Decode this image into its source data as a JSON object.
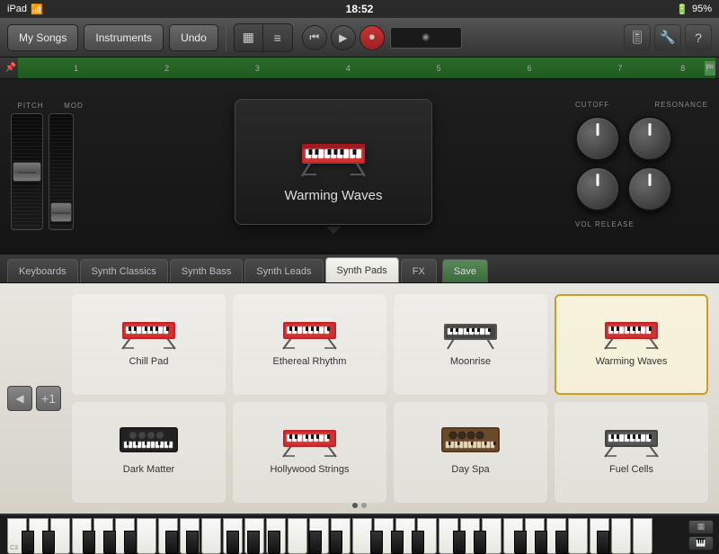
{
  "status_bar": {
    "left": "iPad",
    "wifi": "WiFi",
    "time": "18:52",
    "battery": "95%"
  },
  "toolbar": {
    "my_songs": "My Songs",
    "instruments": "Instruments",
    "undo": "Undo"
  },
  "synth": {
    "pitch_label": "PITCH",
    "mod_label": "MOD",
    "cutoff_label": "CUTOFF",
    "resonance_label": "RESONANCE",
    "vol_release_label": "VOL RELEASE",
    "instrument_name": "Warming Waves"
  },
  "preset_tabs": [
    {
      "id": "keyboards",
      "label": "Keyboards",
      "active": false
    },
    {
      "id": "synth-classics",
      "label": "Synth Classics",
      "active": false
    },
    {
      "id": "synth-bass",
      "label": "Synth Bass",
      "active": false
    },
    {
      "id": "synth-leads",
      "label": "Synth Leads",
      "active": false
    },
    {
      "id": "synth-pads",
      "label": "Synth Pads",
      "active": true
    },
    {
      "id": "fx",
      "label": "FX",
      "active": false
    },
    {
      "id": "save",
      "label": "Save",
      "active": false
    }
  ],
  "instruments": [
    {
      "id": "chill-pad",
      "label": "Chill Pad",
      "type": "keyboard",
      "selected": false
    },
    {
      "id": "ethereal-rhythm",
      "label": "Ethereal Rhythm",
      "type": "keyboard",
      "selected": false
    },
    {
      "id": "moonrise",
      "label": "Moonrise",
      "type": "keyboard2",
      "selected": false
    },
    {
      "id": "warming-waves",
      "label": "Warming Waves",
      "type": "keyboard",
      "selected": true
    },
    {
      "id": "dark-matter",
      "label": "Dark Matter",
      "type": "synth",
      "selected": false
    },
    {
      "id": "hollywood-strings",
      "label": "Hollywood Strings",
      "type": "keyboard",
      "selected": false
    },
    {
      "id": "day-spa",
      "label": "Day Spa",
      "type": "synth2",
      "selected": false
    },
    {
      "id": "fuel-cells",
      "label": "Fuel Cells",
      "type": "keyboard3",
      "selected": false
    }
  ],
  "piano": {
    "label": "C3"
  },
  "pagination": {
    "current": 0,
    "total": 2
  }
}
